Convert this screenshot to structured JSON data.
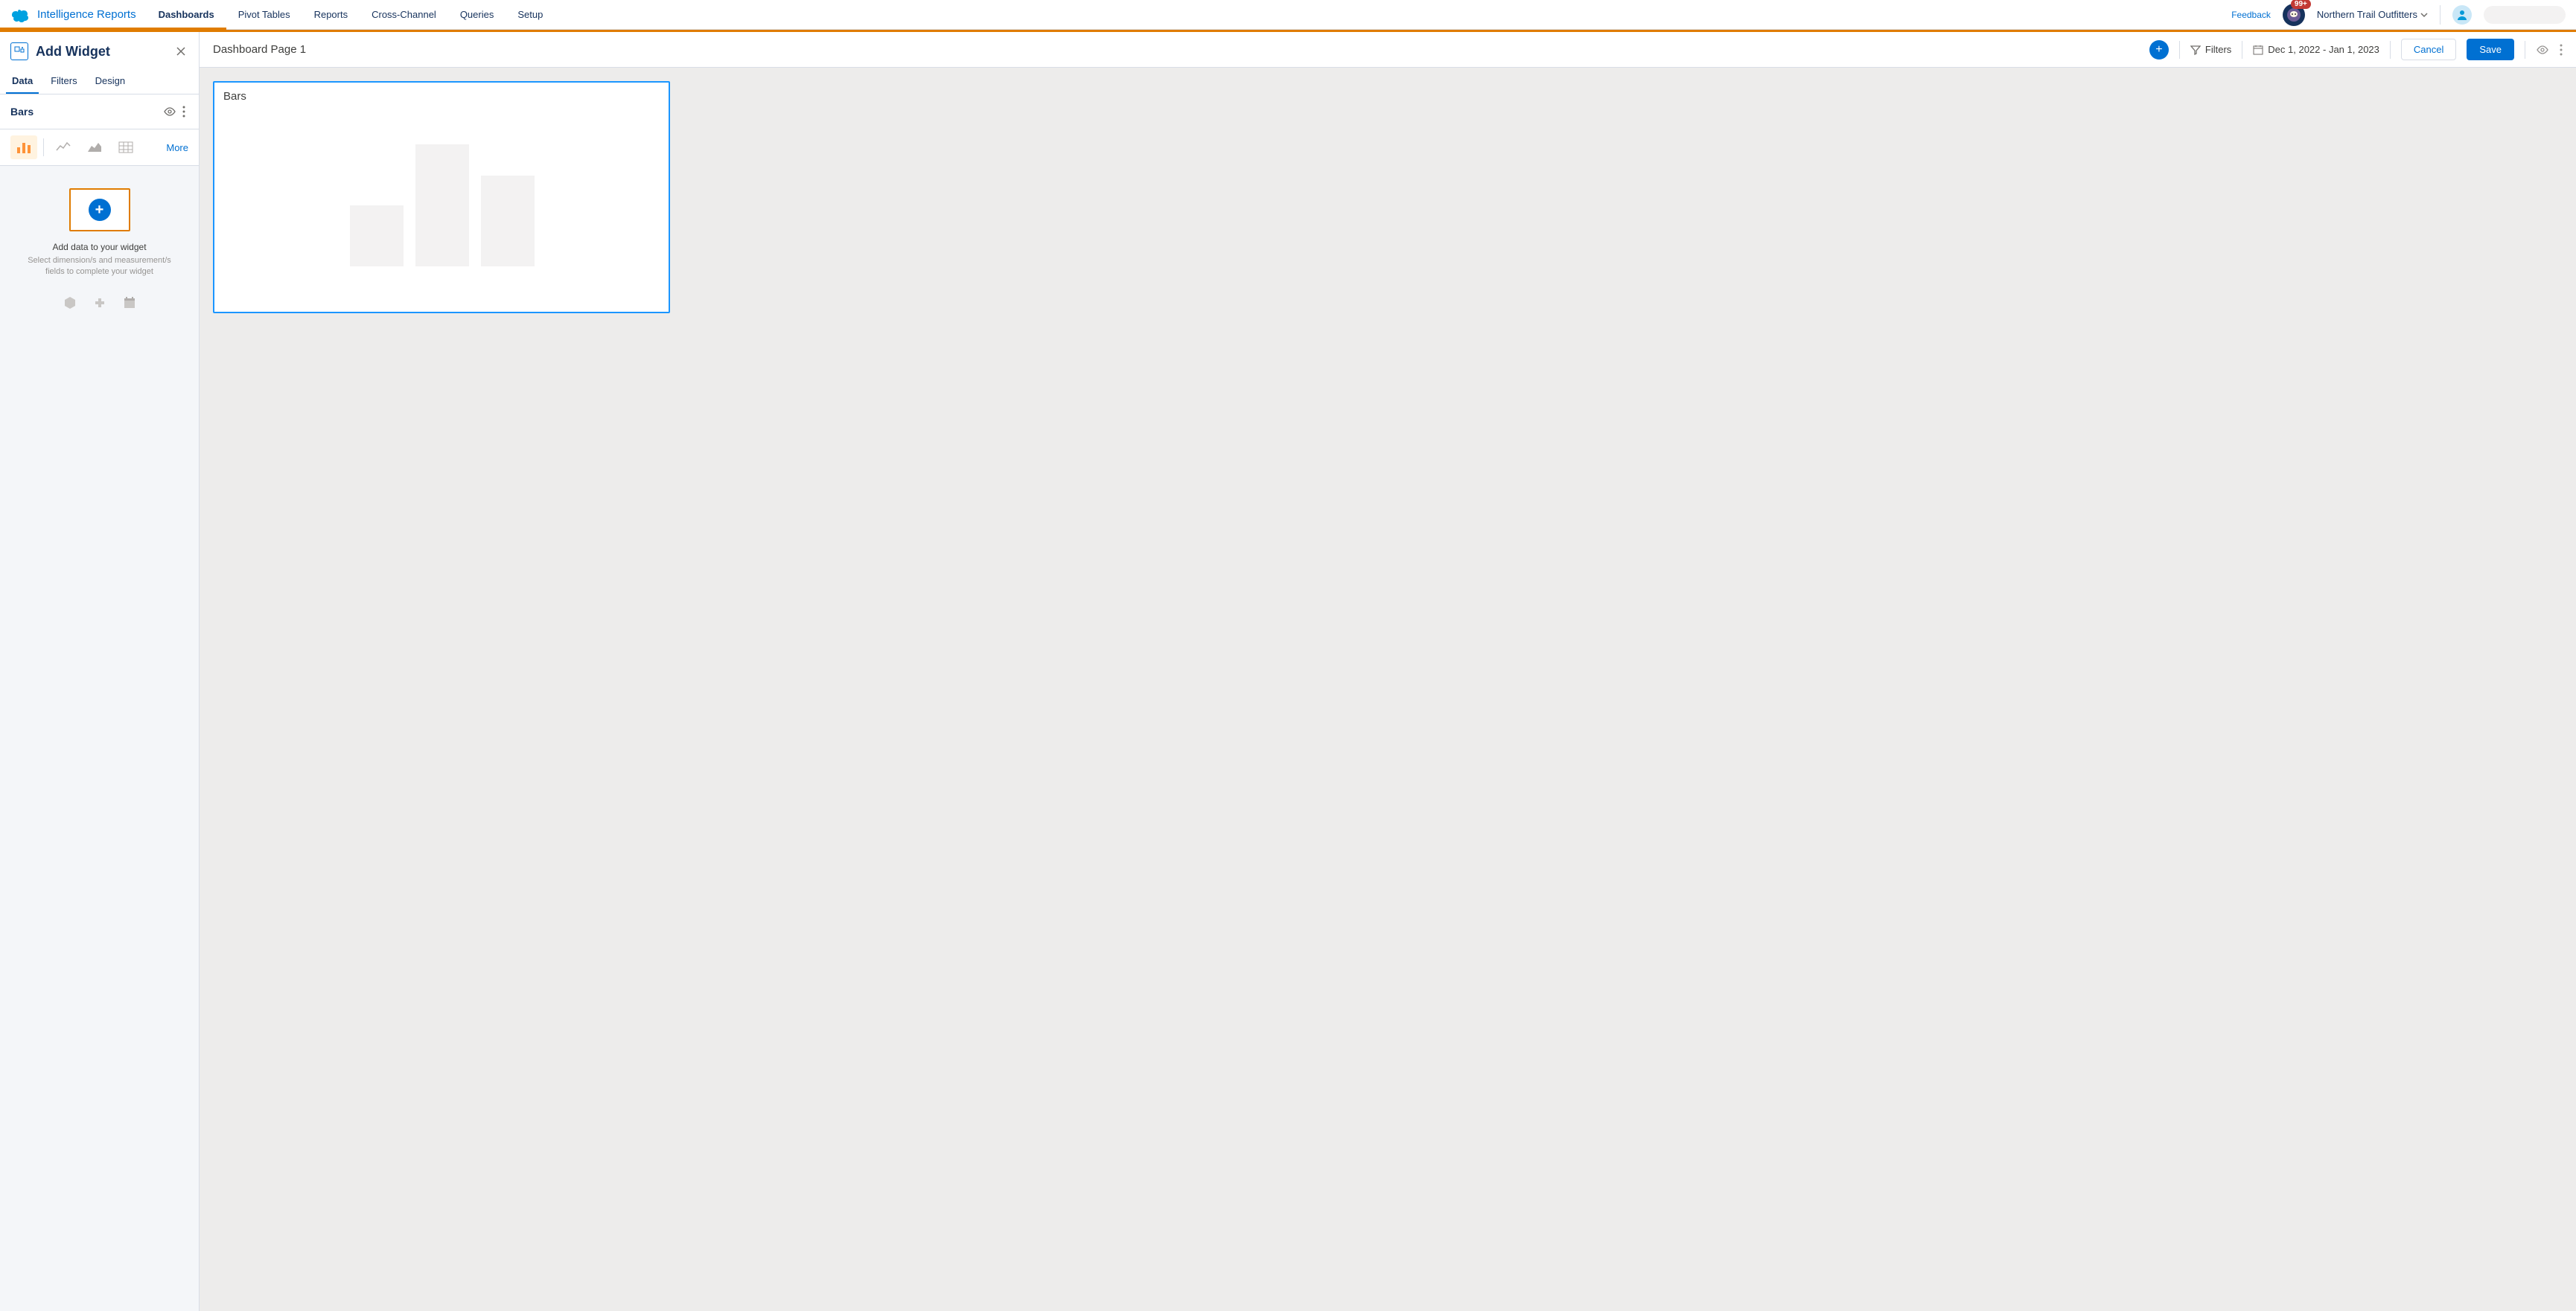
{
  "brand": {
    "name": "Intelligence Reports"
  },
  "nav": {
    "tabs": [
      "Dashboards",
      "Pivot Tables",
      "Reports",
      "Cross-Channel",
      "Queries",
      "Setup"
    ],
    "active": "Dashboards"
  },
  "header_right": {
    "feedback": "Feedback",
    "notification_count": "99+",
    "org_name": "Northern Trail Outfitters"
  },
  "sidebar": {
    "title": "Add Widget",
    "tabs": [
      "Data",
      "Filters",
      "Design"
    ],
    "active_tab": "Data",
    "widget_name": "Bars",
    "chart_types": {
      "bar": "bar-chart-icon",
      "line": "line-chart-icon",
      "area": "area-chart-icon",
      "table": "table-icon",
      "more": "More"
    },
    "add_data": {
      "title": "Add data to your widget",
      "subtitle": "Select dimension/s and measurement/s fields to complete your widget"
    }
  },
  "canvas": {
    "page_name": "Dashboard Page 1",
    "filters_label": "Filters",
    "date_range": "Dec 1, 2022 - Jan 1, 2023",
    "cancel": "Cancel",
    "save": "Save",
    "widget_title": "Bars"
  }
}
